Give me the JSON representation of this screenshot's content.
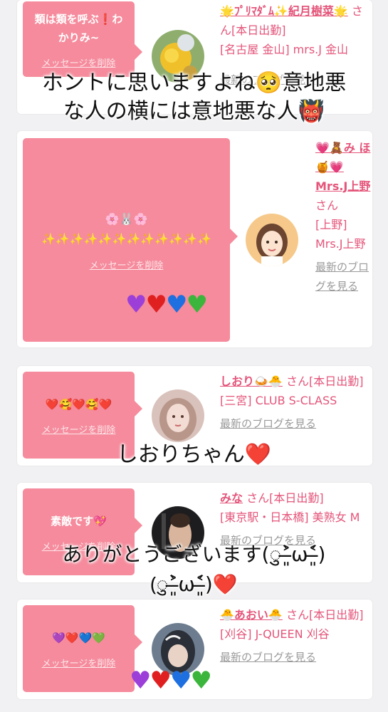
{
  "cards": [
    {
      "message": "類は類を呼ぶ❗️わかりみ~",
      "delete_label": "メッセージを削除",
      "name": "🌟ﾌﾟﾘﾏﾀﾞﾑ✨紀月樹菜🌟",
      "suffix": "さん[本日出勤]",
      "shop": "[名古屋 金山] mrs.J 金山",
      "blog": "最新のブログを見る"
    },
    {
      "message": "🌸🐰🌸 ✨✨✨✨✨✨✨✨✨✨✨✨",
      "delete_label": "メッセージを削除",
      "name": "💗🧸み ほ🍯💗 Mrs.J上野",
      "suffix": "さん",
      "shop": "[上野] Mrs.J上野",
      "blog": "最新のブログを見る"
    },
    {
      "message": "❤️🥰❤️🥰❤️",
      "delete_label": "メッセージを削除",
      "name": "しおり🍛🐣",
      "suffix": "さん[本日出勤]",
      "shop": "[三宮] CLUB S-CLASS",
      "blog": "最新のブログを見る"
    },
    {
      "message": "素敵です💖",
      "delete_label": "メッセージを削除",
      "name": "みな",
      "suffix": "さん[本日出勤]",
      "shop": "[東京駅・日本橋] 美熟女 M",
      "blog": "最新のブログを見る"
    },
    {
      "message": "💜❤️💙💚",
      "delete_label": "メッセージを削除",
      "name": "🐣あおい🐣",
      "suffix": "さん[本日出勤]",
      "shop": "[刈谷] J-QUEEN 刈谷",
      "blog": "最新のブログを見る"
    }
  ],
  "overlays": {
    "top_line1": "ホントに思いますよね🥺意地悪",
    "top_line2": "な人の横には意地悪な人👹",
    "mid": "しおりちゃん❤️",
    "bottom_line1": "ありがとうございます(ु˃̶͈̀ω˂̶͈́)",
    "bottom_line2": "(ु˃̶͈̀ω˂̶͈́)❤️"
  },
  "colors": {
    "bubble": "#f58b9c",
    "name_text": "#e4557a",
    "page_bg": "#f1f1f3"
  }
}
